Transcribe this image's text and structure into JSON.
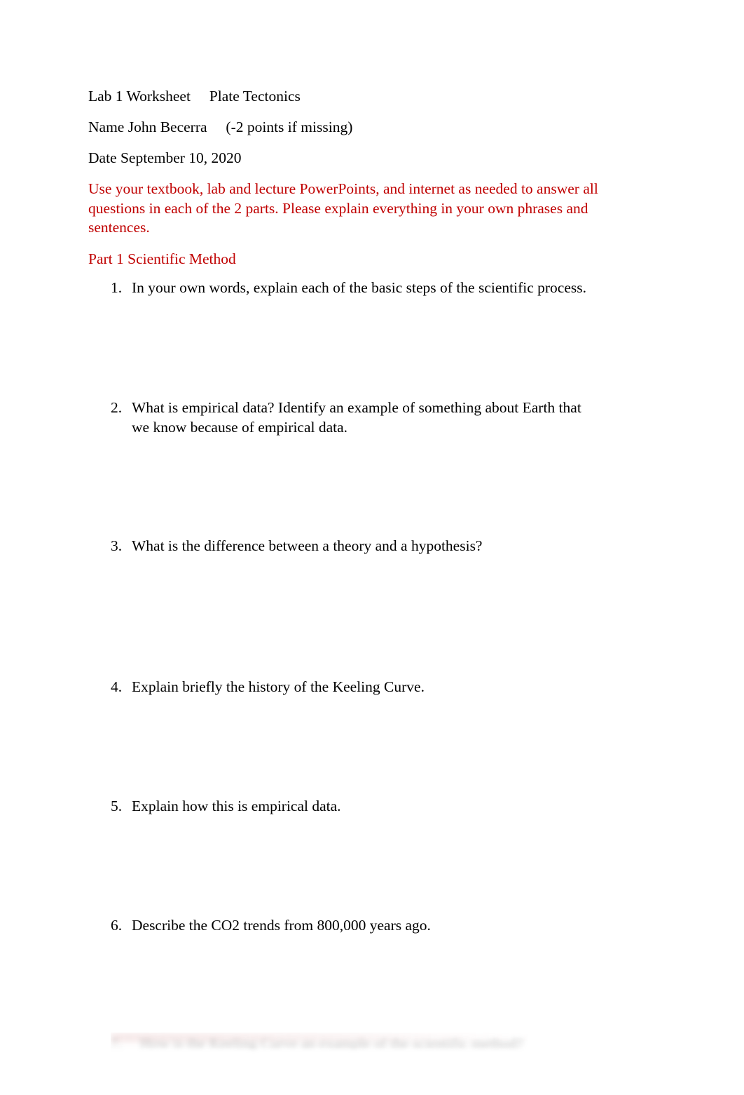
{
  "document": {
    "header_lines": [
      {
        "label": "Lab 1 Worksheet",
        "tab_text": "Plate Tectonics",
        "full": "Lab 1 Worksheet     Plate Tectonics"
      },
      {
        "label": "Name John Becerra",
        "tab_text": "(-2 points if missing)",
        "full": "Name John Becerra     (-2 points if missing)"
      },
      {
        "label": "Date September 10, 2020",
        "tab_text": "",
        "full": "Date September 10, 2020"
      }
    ],
    "instructions": "Use your textbook, lab and lecture PowerPoints, and internet as needed to answer all questions in each of the 2 parts.      Please explain everything in your own phrases and sentences.",
    "part_heading": "Part 1 Scientific Method",
    "questions": [
      {
        "number": "1.",
        "text": "In your own words, explain each of the basic steps of the scientific process."
      },
      {
        "number": "2.",
        "text": "What is empirical data? Identify an example of something about Earth that we know because of empirical data."
      },
      {
        "number": "3.",
        "text": "What is the difference between a theory and a hypothesis?"
      },
      {
        "number": "4.",
        "text": "Explain briefly the history of the Keeling Curve."
      },
      {
        "number": "5.",
        "text": "Explain how this is empirical data."
      },
      {
        "number": "6.",
        "text": "Describe the CO2 trends from 800,000 years ago."
      }
    ],
    "obscured_line": {
      "number": "7.",
      "text": "How is the Keeling Curve an example of the scientific method?",
      "state": "blurred"
    },
    "colors": {
      "text": "#000000",
      "accent_red": "#C00000",
      "page_background": "#FFFFFF"
    }
  }
}
